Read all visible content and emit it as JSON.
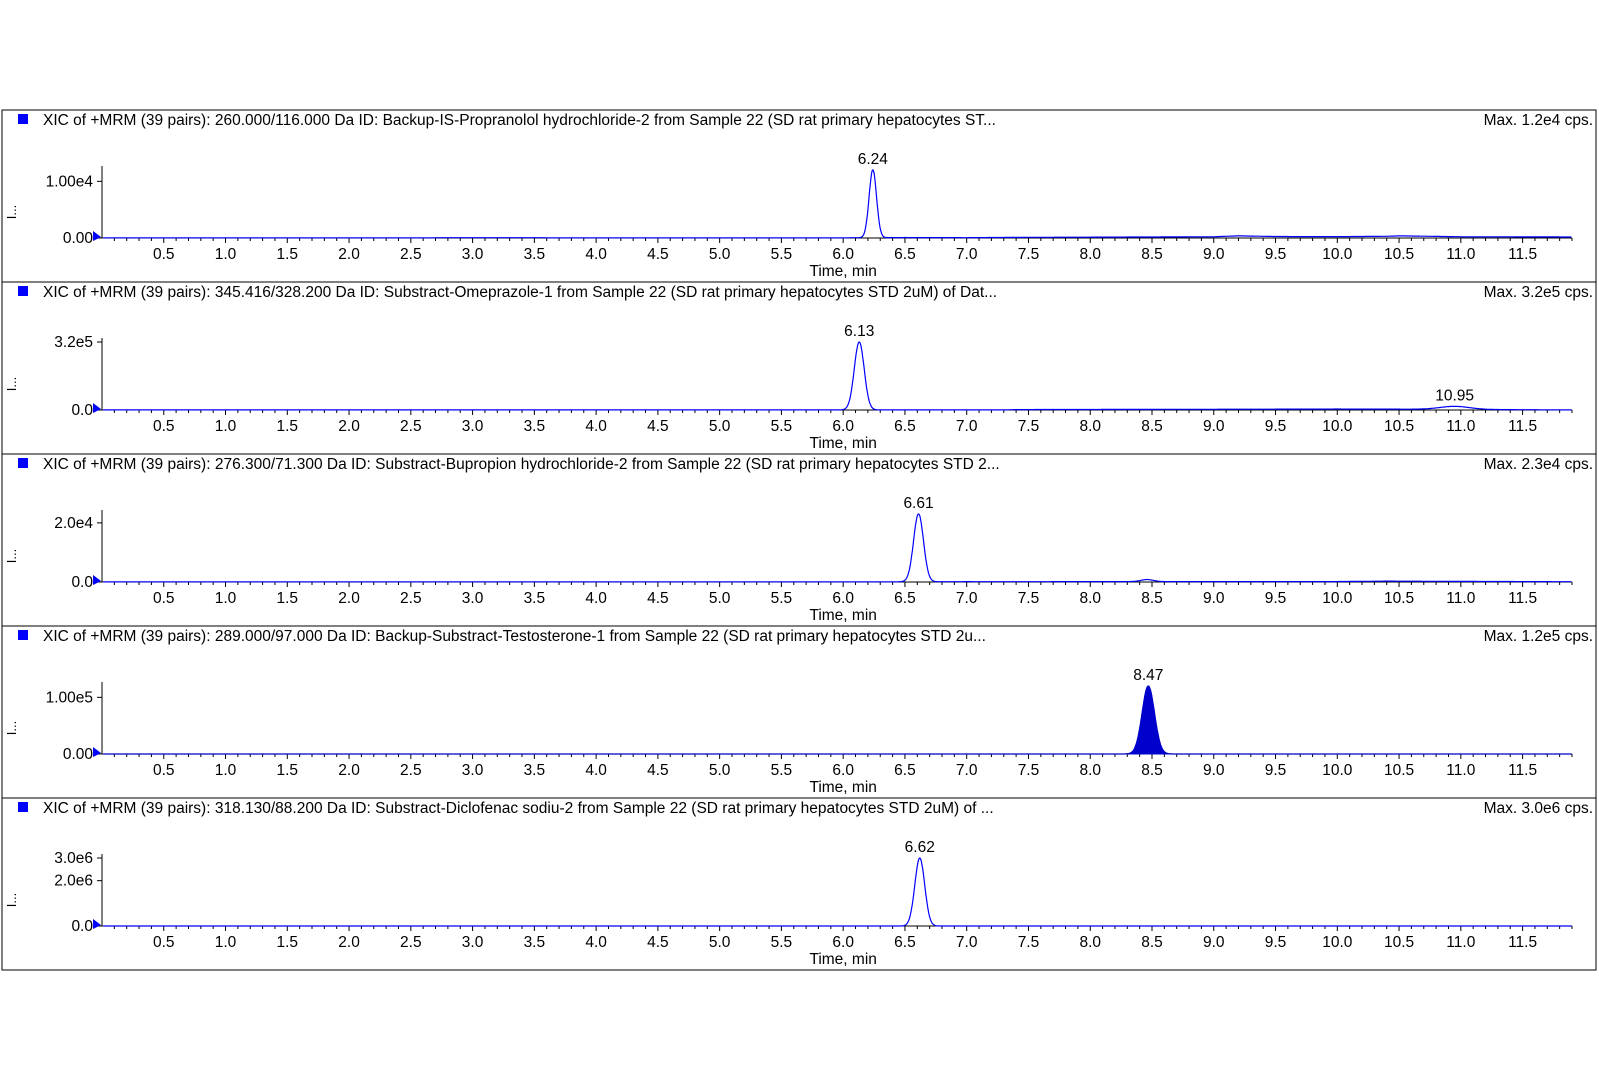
{
  "chart_data": [
    {
      "type": "line",
      "title": "XIC of +MRM (39 pairs): 260.000/116.000 Da ID: Backup-IS-Propranolol hydrochloride-2 from Sample 22 (SD rat primary hepatocytes ST...",
      "max_label": "Max. 1.2e4 cps.",
      "xlabel": "Time, min",
      "ylabel": "I...",
      "xlim": [
        0,
        11.9
      ],
      "ylim": [
        0,
        12000
      ],
      "x_ticks": [
        "0.5",
        "1.0",
        "1.5",
        "2.0",
        "2.5",
        "3.0",
        "3.5",
        "4.0",
        "4.5",
        "5.0",
        "5.5",
        "6.0",
        "6.5",
        "7.0",
        "7.5",
        "8.0",
        "8.5",
        "9.0",
        "9.5",
        "10.0",
        "10.5",
        "11.0",
        "11.5"
      ],
      "y_ticks": [
        {
          "value": 10000,
          "label": "1.00e4"
        },
        {
          "value": 0,
          "label": "0.00"
        }
      ],
      "series_color": "#0000ff",
      "filled": false,
      "peaks": [
        {
          "rt": 6.24,
          "height": 12000,
          "width": 0.03,
          "label": "6.24"
        }
      ],
      "baseline": [
        [
          0,
          30
        ],
        [
          1,
          40
        ],
        [
          2,
          30
        ],
        [
          3,
          50
        ],
        [
          4,
          40
        ],
        [
          5,
          30
        ],
        [
          6,
          40
        ],
        [
          6.5,
          80
        ],
        [
          7,
          60
        ],
        [
          7.5,
          120
        ],
        [
          8,
          150
        ],
        [
          8.5,
          180
        ],
        [
          9,
          220
        ],
        [
          9.2,
          380
        ],
        [
          9.5,
          260
        ],
        [
          10,
          240
        ],
        [
          10.4,
          300
        ],
        [
          10.5,
          380
        ],
        [
          11,
          220
        ],
        [
          11.5,
          200
        ],
        [
          11.9,
          180
        ]
      ]
    },
    {
      "type": "line",
      "title": "XIC of +MRM (39 pairs): 345.416/328.200 Da ID: Substract-Omeprazole-1 from Sample 22 (SD rat primary hepatocytes STD 2uM) of Dat...",
      "max_label": "Max. 3.2e5 cps.",
      "xlabel": "Time, min",
      "ylabel": "I...",
      "xlim": [
        0,
        11.9
      ],
      "ylim": [
        0,
        320000
      ],
      "x_ticks": [
        "0.5",
        "1.0",
        "1.5",
        "2.0",
        "2.5",
        "3.0",
        "3.5",
        "4.0",
        "4.5",
        "5.0",
        "5.5",
        "6.0",
        "6.5",
        "7.0",
        "7.5",
        "8.0",
        "8.5",
        "9.0",
        "9.5",
        "10.0",
        "10.5",
        "11.0",
        "11.5"
      ],
      "y_ticks": [
        {
          "value": 320000,
          "label": "3.2e5"
        },
        {
          "value": 0,
          "label": "0.0"
        }
      ],
      "series_color": "#0000ff",
      "filled": false,
      "peaks": [
        {
          "rt": 6.13,
          "height": 320000,
          "width": 0.04,
          "label": "6.13"
        },
        {
          "rt": 10.95,
          "height": 14000,
          "width": 0.12,
          "label": "10.95"
        }
      ],
      "baseline": [
        [
          0,
          500
        ],
        [
          7.3,
          500
        ],
        [
          7.4,
          2000
        ],
        [
          8,
          2500
        ],
        [
          8.5,
          3000
        ],
        [
          9,
          3500
        ],
        [
          9.5,
          4000
        ],
        [
          10,
          4500
        ],
        [
          10.5,
          4000
        ],
        [
          11,
          3000
        ],
        [
          11.3,
          2000
        ],
        [
          11.9,
          500
        ]
      ]
    },
    {
      "type": "line",
      "title": "XIC of +MRM (39 pairs): 276.300/71.300 Da ID: Substract-Bupropion hydrochloride-2 from Sample 22 (SD rat primary hepatocytes STD 2...",
      "max_label": "Max. 2.3e4 cps.",
      "xlabel": "Time, min",
      "ylabel": "I...",
      "xlim": [
        0,
        11.9
      ],
      "ylim": [
        0,
        23000
      ],
      "x_ticks": [
        "0.5",
        "1.0",
        "1.5",
        "2.0",
        "2.5",
        "3.0",
        "3.5",
        "4.0",
        "4.5",
        "5.0",
        "5.5",
        "6.0",
        "6.5",
        "7.0",
        "7.5",
        "8.0",
        "8.5",
        "9.0",
        "9.5",
        "10.0",
        "10.5",
        "11.0",
        "11.5"
      ],
      "y_ticks": [
        {
          "value": 20000,
          "label": "2.0e4"
        },
        {
          "value": 0,
          "label": "0.0"
        }
      ],
      "series_color": "#0000ff",
      "filled": false,
      "peaks": [
        {
          "rt": 6.61,
          "height": 23000,
          "width": 0.04,
          "label": "6.61"
        },
        {
          "rt": 8.46,
          "height": 700,
          "width": 0.05
        }
      ],
      "baseline": [
        [
          0,
          50
        ],
        [
          6.5,
          80
        ],
        [
          7,
          120
        ],
        [
          7.5,
          100
        ],
        [
          8,
          150
        ],
        [
          9,
          120
        ],
        [
          10,
          150
        ],
        [
          10.4,
          300
        ],
        [
          11,
          200
        ],
        [
          11.9,
          100
        ]
      ]
    },
    {
      "type": "area",
      "title": "XIC of +MRM (39 pairs): 289.000/97.000 Da ID: Backup-Substract-Testosterone-1 from Sample 22 (SD rat primary hepatocytes STD 2u...",
      "max_label": "Max. 1.2e5 cps.",
      "xlabel": "Time, min",
      "ylabel": "I...",
      "xlim": [
        0,
        11.9
      ],
      "ylim": [
        0,
        120000
      ],
      "x_ticks": [
        "0.5",
        "1.0",
        "1.5",
        "2.0",
        "2.5",
        "3.0",
        "3.5",
        "4.0",
        "4.5",
        "5.0",
        "5.5",
        "6.0",
        "6.5",
        "7.0",
        "7.5",
        "8.0",
        "8.5",
        "9.0",
        "9.5",
        "10.0",
        "10.5",
        "11.0",
        "11.5"
      ],
      "y_ticks": [
        {
          "value": 100000,
          "label": "1.00e5"
        },
        {
          "value": 0,
          "label": "0.00"
        }
      ],
      "series_color": "#0000cc",
      "filled": true,
      "peaks": [
        {
          "rt": 8.47,
          "height": 120000,
          "width": 0.05,
          "label": "8.47"
        }
      ],
      "baseline": [
        [
          0,
          0
        ],
        [
          11.9,
          0
        ]
      ]
    },
    {
      "type": "line",
      "title": "XIC of +MRM (39 pairs): 318.130/88.200 Da ID: Substract-Diclofenac sodiu-2 from Sample 22 (SD rat primary hepatocytes STD 2uM) of ...",
      "max_label": "Max. 3.0e6 cps.",
      "xlabel": "Time, min",
      "ylabel": "I...",
      "xlim": [
        0,
        11.9
      ],
      "ylim": [
        0,
        3000000
      ],
      "x_ticks": [
        "0.5",
        "1.0",
        "1.5",
        "2.0",
        "2.5",
        "3.0",
        "3.5",
        "4.0",
        "4.5",
        "5.0",
        "5.5",
        "6.0",
        "6.5",
        "7.0",
        "7.5",
        "8.0",
        "8.5",
        "9.0",
        "9.5",
        "10.0",
        "10.5",
        "11.0",
        "11.5"
      ],
      "y_ticks": [
        {
          "value": 3000000,
          "label": "3.0e6"
        },
        {
          "value": 2000000,
          "label": "2.0e6"
        },
        {
          "value": 0,
          "label": "0.0"
        }
      ],
      "series_color": "#0000ff",
      "filled": false,
      "peaks": [
        {
          "rt": 6.62,
          "height": 3000000,
          "width": 0.04,
          "label": "6.62"
        }
      ],
      "baseline": [
        [
          0,
          0
        ],
        [
          11.9,
          0
        ]
      ]
    }
  ]
}
